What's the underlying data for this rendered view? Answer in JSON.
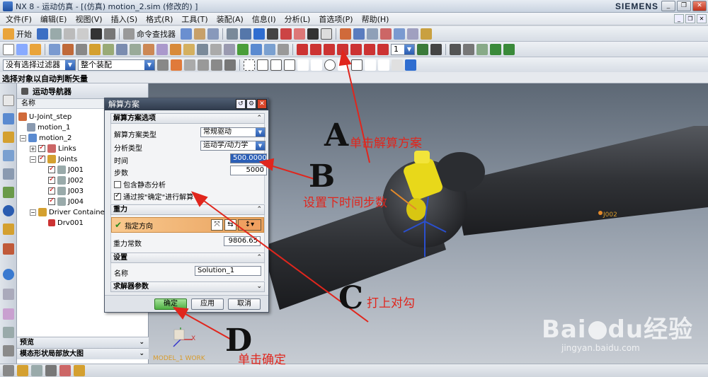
{
  "window": {
    "title": "NX 8 - 运动仿真 - [(仿真) motion_2.sim  (修改的) ]",
    "brand": "SIEMENS",
    "controls": [
      "_",
      "❐",
      "✕"
    ]
  },
  "menu": {
    "items": [
      "文件(F)",
      "编辑(E)",
      "视图(V)",
      "插入(S)",
      "格式(R)",
      "工具(T)",
      "装配(A)",
      "信息(I)",
      "分析(L)",
      "首选项(P)",
      "帮助(H)"
    ]
  },
  "toolbar1": {
    "start_label": "开始",
    "command_finder_label": "命令查找器"
  },
  "toolbar3": {
    "filter_value": "没有选择过滤器",
    "scope_value": "整个装配",
    "step_value": "1"
  },
  "status_prompt": "选择对象以自动判断矢量",
  "navigator": {
    "title": "运动导航器",
    "col_name": "名称",
    "tree": [
      {
        "label": "U-Joint_step",
        "level": 0
      },
      {
        "label": "motion_1",
        "level": 1
      },
      {
        "label": "motion_2",
        "level": 1
      },
      {
        "label": "Links",
        "level": 2
      },
      {
        "label": "Joints",
        "level": 2
      },
      {
        "label": "J001",
        "level": 3
      },
      {
        "label": "J002",
        "level": 3
      },
      {
        "label": "J003",
        "level": 3
      },
      {
        "label": "J004",
        "level": 3
      },
      {
        "label": "Driver Container",
        "level": 2
      },
      {
        "label": "Drv001",
        "level": 3
      }
    ],
    "bottom_panels": [
      "预览",
      "模态形状局部放大图"
    ]
  },
  "viewport": {
    "label_j002": "J002",
    "label_model": "MODEL_1 WORK",
    "axis_x": "X"
  },
  "dialog": {
    "title": "解算方案",
    "sections": {
      "options": "解算方案选项",
      "gravity": "重力",
      "settings": "设置",
      "solver": "求解器参数"
    },
    "solution_type_label": "解算方案类型",
    "solution_type_value": "常规驱动",
    "analysis_type_label": "分析类型",
    "analysis_type_value": "运动学/动力学",
    "time_label": "时间",
    "time_value": "500.0000",
    "steps_label": "步数",
    "steps_value": "5000",
    "static_check_label": "包含静态分析",
    "static_checked": false,
    "ok_solve_label": "通过按\"确定\"进行解算",
    "ok_solve_checked": true,
    "vector_label": "指定方向",
    "gravity_const_label": "重力常数",
    "gravity_const_value": "9806.65",
    "name_label": "名称",
    "name_value": "Solution_1",
    "btn_ok": "确定",
    "btn_apply": "应用",
    "btn_cancel": "取消"
  },
  "annotations": {
    "A": {
      "letter": "A",
      "text": "单击解算方案"
    },
    "B": {
      "letter": "B",
      "text": "设置下时间步数"
    },
    "C": {
      "letter": "C",
      "text": "打上对勾"
    },
    "D": {
      "letter": "D",
      "text": "单击确定"
    }
  },
  "watermark": {
    "brand": "Bai",
    "brand_mid": "du",
    "brand_cn": "经验",
    "url": "jingyan.baidu.com"
  },
  "colors": {
    "accent_blue": "#2a5cb0",
    "annotation_red": "#e0261d",
    "ok_green": "#4fb043"
  }
}
